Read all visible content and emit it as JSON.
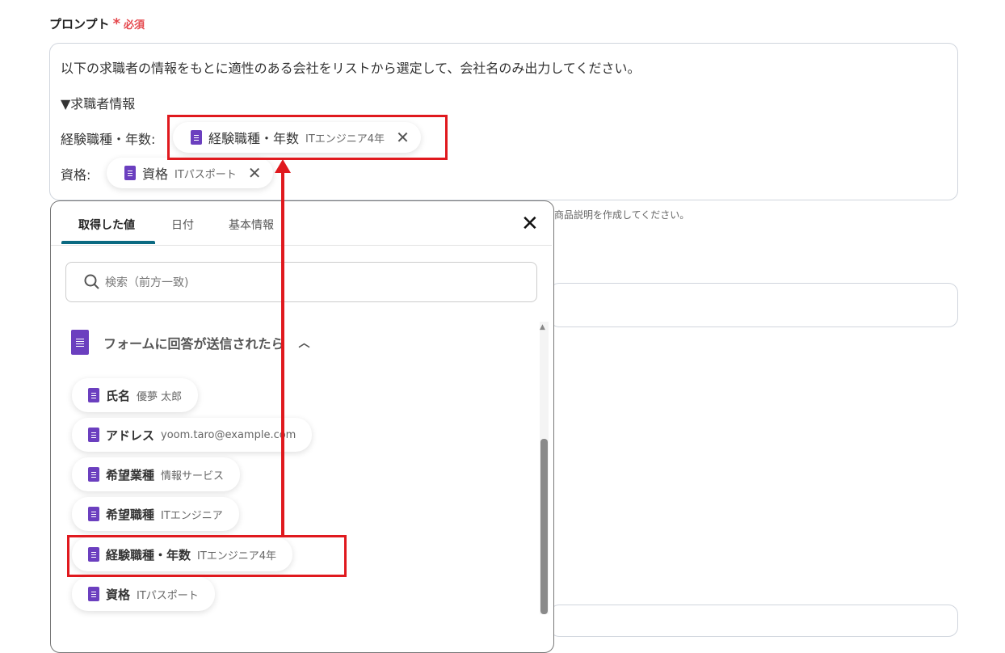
{
  "field": {
    "label": "プロンプト",
    "required_mark": "*",
    "required_text": "必須"
  },
  "prompt": {
    "line1": "以下の求職者の情報をもとに適性のある会社をリストから選定して、会社名のみ出力してください。",
    "line2": "▼求職者情報",
    "line3_label": "経験職種・年数:",
    "line3_chip": {
      "key": "経験職種・年数",
      "value": "ITエンジニア4年"
    },
    "line4_label": "資格:",
    "line4_chip": {
      "key": "資格",
      "value": "ITパスポート"
    }
  },
  "help_text": "商品説明を作成してください。",
  "popup": {
    "tabs": [
      "取得した値",
      "日付",
      "基本情報"
    ],
    "search_placeholder": "検索（前方一致)",
    "group_title": "フォームに回答が送信されたら",
    "items": [
      {
        "key": "氏名",
        "value": "優夢 太郎"
      },
      {
        "key": "アドレス",
        "value": "yoom.taro@example.com"
      },
      {
        "key": "希望業種",
        "value": "情報サービス"
      },
      {
        "key": "希望職種",
        "value": "ITエンジニア"
      },
      {
        "key": "経験職種・年数",
        "value": "ITエンジニア4年"
      },
      {
        "key": "資格",
        "value": "ITパスポート"
      }
    ]
  },
  "colors": {
    "accent": "#0b6a82",
    "highlight": "#e0191e",
    "form_icon": "#6b3fbf",
    "required": "#e5484d"
  }
}
